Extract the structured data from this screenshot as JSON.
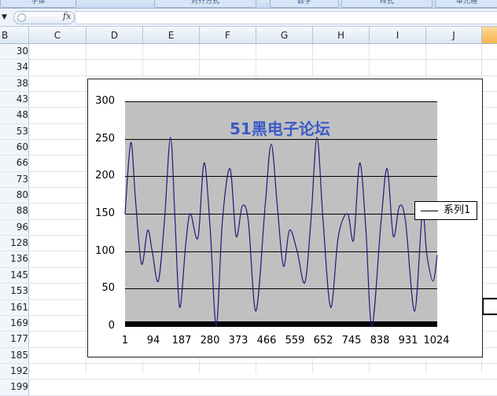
{
  "ribbon_groups": [
    "字体",
    "对齐方式",
    "数字",
    "样式",
    "单元格"
  ],
  "formula_bar": {
    "fx_label": "fx",
    "formula": ""
  },
  "columns": [
    "B",
    "C",
    "D",
    "E",
    "F",
    "G",
    "H",
    "I",
    "J"
  ],
  "row_values": [
    "30",
    "34",
    "38",
    "43",
    "48",
    "53",
    "60",
    "66",
    "73",
    "80",
    "88",
    "96",
    "128",
    "136",
    "145",
    "153",
    "161",
    "169",
    "177",
    "185",
    "192",
    "199"
  ],
  "chart_data": {
    "type": "line",
    "title": "",
    "watermark": "51黑电子论坛",
    "legend": {
      "position": "right",
      "entries": [
        "系列1"
      ]
    },
    "yticks": [
      "0",
      "50",
      "100",
      "150",
      "200",
      "250",
      "300"
    ],
    "xticks": [
      "1",
      "94",
      "187",
      "280",
      "373",
      "466",
      "559",
      "652",
      "745",
      "838",
      "931",
      "1024"
    ],
    "ylim": [
      0,
      300
    ],
    "xlim": [
      1,
      1024
    ],
    "grid": true,
    "series": [
      {
        "name": "系列1",
        "color": "#1c1c7a",
        "x": [
          1,
          20,
          35,
          55,
          75,
          90,
          110,
          130,
          150,
          165,
          180,
          200,
          215,
          240,
          260,
          280,
          300,
          320,
          345,
          365,
          385,
          405,
          430,
          460,
          480,
          500,
          520,
          540,
          565,
          590,
          610,
          630,
          650,
          675,
          700,
          730,
          750,
          770,
          790,
          810,
          840,
          860,
          880,
          900,
          920,
          950,
          975,
          990,
          1010,
          1024
        ],
        "y": [
          150,
          245,
          170,
          83,
          128,
          100,
          60,
          140,
          252,
          140,
          25,
          110,
          150,
          118,
          218,
          130,
          0,
          140,
          210,
          120,
          160,
          140,
          20,
          160,
          243,
          160,
          80,
          128,
          100,
          58,
          140,
          252,
          140,
          25,
          120,
          150,
          115,
          218,
          130,
          0,
          140,
          210,
          120,
          160,
          140,
          20,
          150,
          95,
          60,
          95
        ]
      }
    ]
  }
}
